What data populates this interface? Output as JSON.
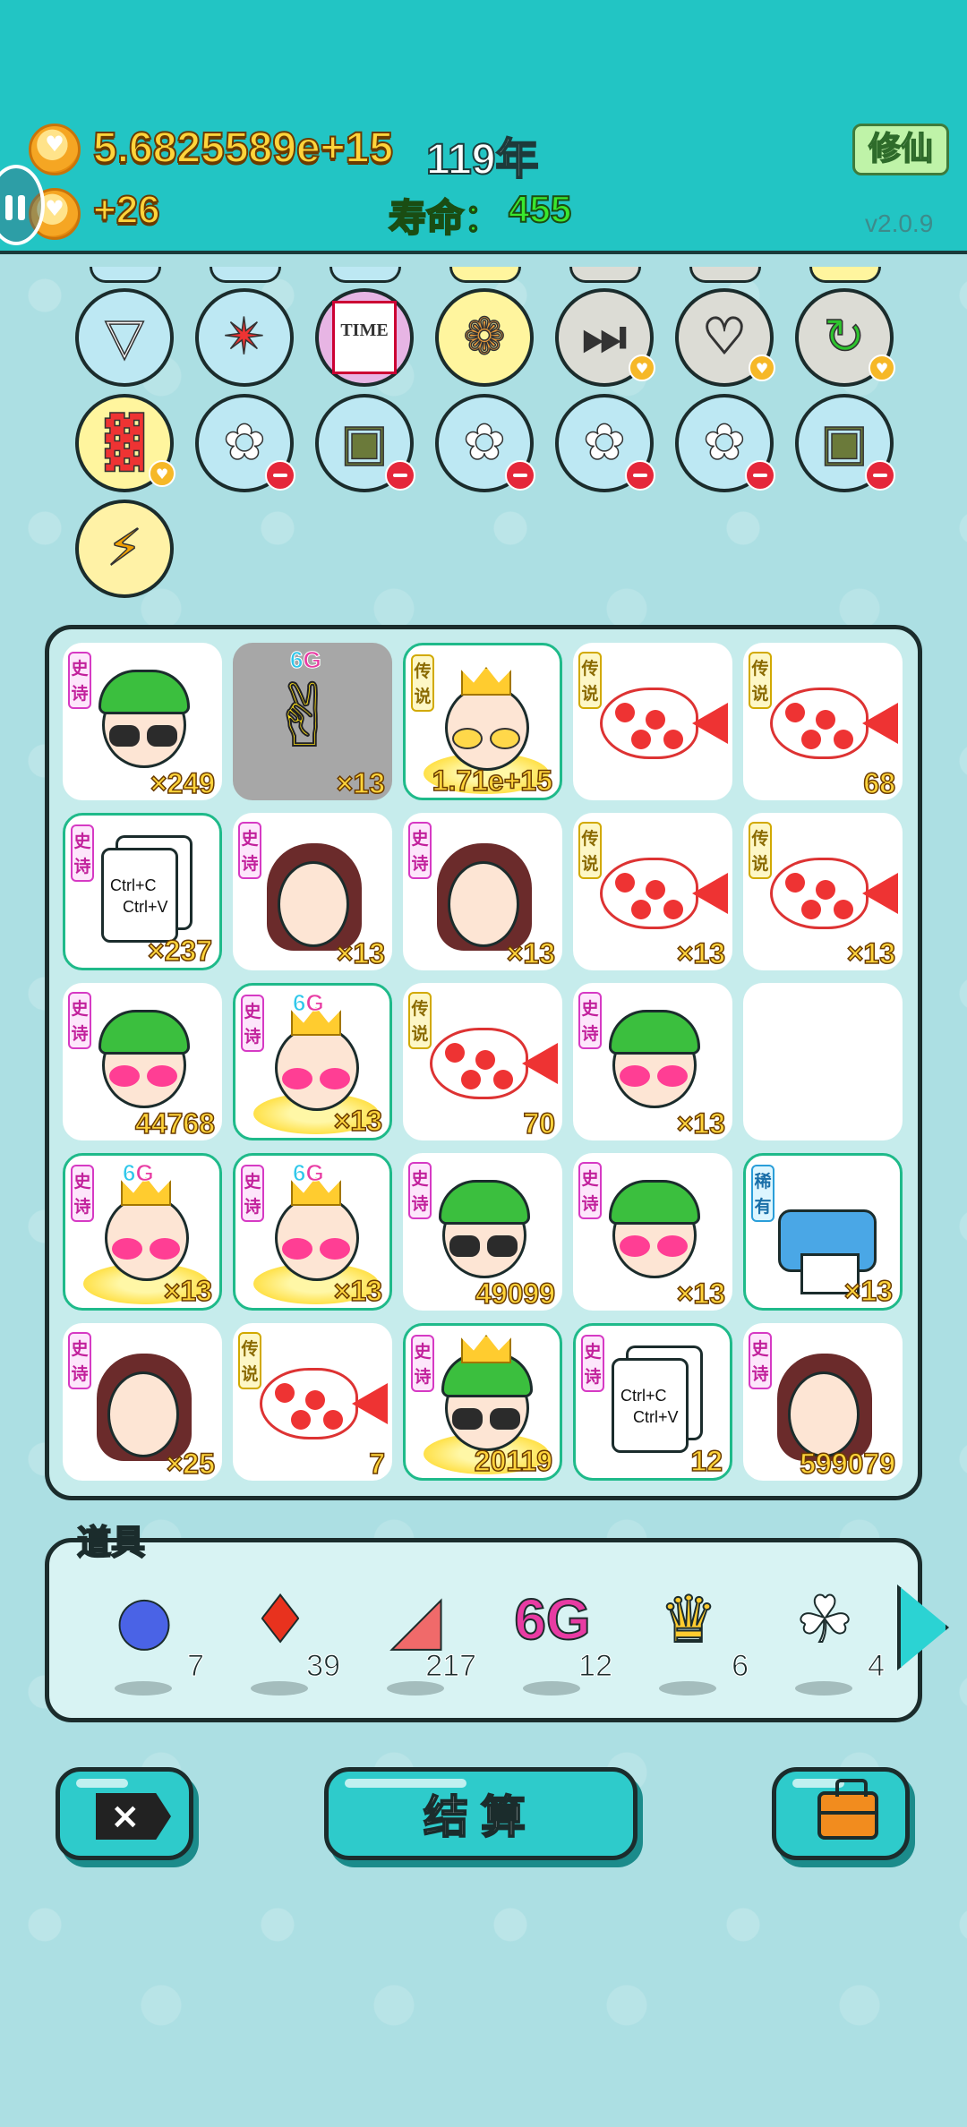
{
  "header": {
    "coins": "5.6825589e+15",
    "year": "119年",
    "income": "+26",
    "lifespan_label": "寿命：",
    "lifespan_value": "455",
    "cultivate_button": "修仙",
    "version": "v2.0.9"
  },
  "tools": [
    {
      "name": "skirt",
      "icon": "skirt-icon",
      "bg": "#bde8f3",
      "badge": ""
    },
    {
      "name": "compass",
      "icon": "compass-icon",
      "bg": "#bde8f3",
      "badge": ""
    },
    {
      "name": "time-magazine",
      "icon": "time-magazine-icon",
      "bg": "#e7b5e4",
      "badge": "",
      "text": "TIME"
    },
    {
      "name": "shell",
      "icon": "shell-icon",
      "bg": "#fff59e",
      "badge": ""
    },
    {
      "name": "skip",
      "icon": "skip-icon",
      "bg": "#dcdcd5",
      "badge": "heart"
    },
    {
      "name": "rabbit",
      "icon": "rabbit-icon",
      "bg": "#dcdcd5",
      "badge": "heart"
    },
    {
      "name": "refresh",
      "icon": "refresh-icon",
      "bg": "#dcdcd5",
      "badge": "heart"
    },
    {
      "name": "fries",
      "icon": "fries-icon",
      "bg": "#fff59e",
      "badge": "heart"
    },
    {
      "name": "flower-pot",
      "icon": "flower-pot-icon",
      "bg": "#bde8f3",
      "badge": "minus"
    },
    {
      "name": "sack",
      "icon": "sack-icon",
      "bg": "#bde8f3",
      "badge": "minus"
    },
    {
      "name": "flower-pot",
      "icon": "flower-pot-icon",
      "bg": "#bde8f3",
      "badge": "minus"
    },
    {
      "name": "flower-pot",
      "icon": "flower-pot-icon",
      "bg": "#bde8f3",
      "badge": "minus"
    },
    {
      "name": "flower-pot",
      "icon": "flower-pot-icon",
      "bg": "#bde8f3",
      "badge": "minus"
    },
    {
      "name": "sack",
      "icon": "sack-icon",
      "bg": "#bde8f3",
      "badge": "minus"
    },
    {
      "name": "lightning",
      "icon": "lightning-icon",
      "bg": "#fff2a6",
      "badge": ""
    }
  ],
  "grid": [
    {
      "type": "green-hat-man",
      "tag": "史诗",
      "tagClass": "epic",
      "count": "×249",
      "hl": false
    },
    {
      "type": "hand-6g",
      "tag": "",
      "count": "×13",
      "hl": false,
      "gray": true,
      "sixg": "6G"
    },
    {
      "type": "crowned-old-man",
      "tag": "传说",
      "tagClass": "legend",
      "count": "1.71e+15",
      "hl": true
    },
    {
      "type": "koi-fish",
      "tag": "传说",
      "tagClass": "legend",
      "count": "",
      "hl": false
    },
    {
      "type": "koi-fish",
      "tag": "传说",
      "tagClass": "legend",
      "count": "68",
      "hl": false
    },
    {
      "type": "copy-paste",
      "tag": "史诗",
      "tagClass": "epic",
      "count": "×237",
      "hl": true,
      "text1": "Ctrl+C",
      "text2": "Ctrl+V"
    },
    {
      "type": "braid-girl",
      "tag": "史诗",
      "tagClass": "epic",
      "count": "×13",
      "hl": false
    },
    {
      "type": "braid-girl",
      "tag": "史诗",
      "tagClass": "epic",
      "count": "×13",
      "hl": false
    },
    {
      "type": "koi-fish",
      "tag": "传说",
      "tagClass": "legend",
      "count": "×13",
      "hl": false
    },
    {
      "type": "koi-fish",
      "tag": "传说",
      "tagClass": "legend",
      "count": "×13",
      "hl": false
    },
    {
      "type": "green-hat-pink-glasses",
      "tag": "史诗",
      "tagClass": "epic",
      "count": "44768",
      "hl": false
    },
    {
      "type": "crowned-pink-6g",
      "tag": "史诗",
      "tagClass": "epic",
      "count": "×13",
      "hl": true,
      "sixg": "6G"
    },
    {
      "type": "koi-fish",
      "tag": "传说",
      "tagClass": "legend",
      "count": "70",
      "hl": false
    },
    {
      "type": "green-hat-pink-glasses",
      "tag": "史诗",
      "tagClass": "epic",
      "count": "×13",
      "hl": false
    },
    {
      "type": "empty",
      "tag": "",
      "count": "",
      "hl": false
    },
    {
      "type": "crowned-pink-6g",
      "tag": "史诗",
      "tagClass": "epic",
      "count": "×13",
      "hl": true,
      "sixg": "6G"
    },
    {
      "type": "crowned-pink-6g",
      "tag": "史诗",
      "tagClass": "epic",
      "count": "×13",
      "hl": true,
      "sixg": "6G"
    },
    {
      "type": "green-hat-man",
      "tag": "史诗",
      "tagClass": "epic",
      "count": "49099",
      "hl": false
    },
    {
      "type": "green-hat-pink-glasses",
      "tag": "史诗",
      "tagClass": "epic",
      "count": "×13",
      "hl": false
    },
    {
      "type": "printer",
      "tag": "稀有",
      "tagClass": "rare",
      "count": "×13",
      "hl": true
    },
    {
      "type": "braid-girl",
      "tag": "史诗",
      "tagClass": "epic",
      "count": "×25",
      "hl": false
    },
    {
      "type": "koi-fish",
      "tag": "传说",
      "tagClass": "legend",
      "count": "7",
      "hl": false
    },
    {
      "type": "crowned-green-hat",
      "tag": "史诗",
      "tagClass": "epic",
      "count": "20119",
      "hl": true
    },
    {
      "type": "copy-paste",
      "tag": "史诗",
      "tagClass": "epic",
      "count": "12",
      "hl": true,
      "text1": "Ctrl+C",
      "text2": "Ctrl+V"
    },
    {
      "type": "braid-girl",
      "tag": "史诗",
      "tagClass": "epic",
      "count": "599079",
      "hl": false
    }
  ],
  "props": {
    "label": "道具",
    "items": [
      {
        "name": "blueberry",
        "icon": "blueberry-icon",
        "count": "7"
      },
      {
        "name": "chili",
        "icon": "chili-icon",
        "count": "39"
      },
      {
        "name": "liver",
        "icon": "liver-icon",
        "count": "217"
      },
      {
        "name": "6g",
        "icon": "6g-icon",
        "count": "12"
      },
      {
        "name": "crown",
        "icon": "crown-icon",
        "count": "6"
      },
      {
        "name": "bird",
        "icon": "bird-icon",
        "count": "4"
      }
    ]
  },
  "bottom": {
    "settle_label": "结算",
    "close_label": "×"
  }
}
